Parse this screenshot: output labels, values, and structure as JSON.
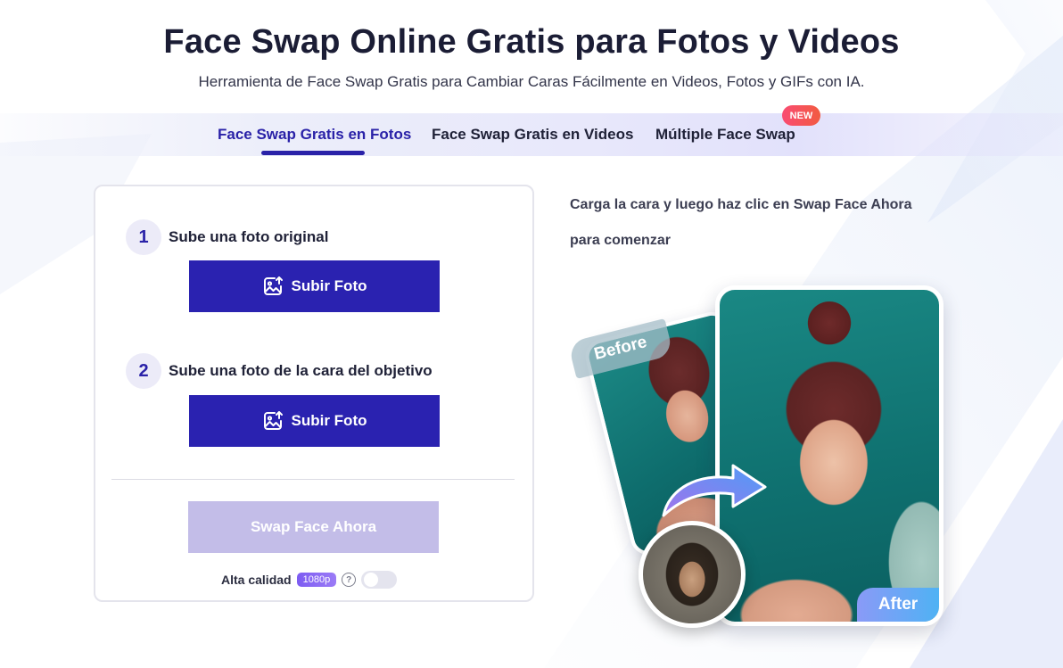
{
  "hero": {
    "title": "Face Swap Online Gratis para Fotos y Videos",
    "subtitle": "Herramienta de Face Swap Gratis para Cambiar Caras Fácilmente en Videos, Fotos y GIFs con IA."
  },
  "tabs": [
    {
      "label": "Face Swap Gratis en Fotos",
      "active": true
    },
    {
      "label": "Face Swap Gratis en Videos",
      "active": false
    },
    {
      "label": "Múltiple Face Swap",
      "active": false,
      "badge": "NEW"
    }
  ],
  "panel": {
    "steps": [
      {
        "number": "1",
        "label": "Sube una foto original",
        "button": "Subir Foto",
        "icon": "image-upload-icon"
      },
      {
        "number": "2",
        "label": "Sube una foto de la cara del objetivo",
        "button": "Subir Foto",
        "icon": "image-upload-icon"
      }
    ],
    "swap_button": "Swap Face Ahora",
    "quality": {
      "label": "Alta calidad",
      "resolution": "1080p",
      "help": "?",
      "enabled": false
    }
  },
  "instructions": {
    "line1": "Carga la cara y luego haz clic en Swap Face Ahora",
    "line2": "para comenzar"
  },
  "illustration": {
    "before_label": "Before",
    "after_label": "After"
  },
  "colors": {
    "primary": "#2a22b0",
    "primary_disabled": "#c3bde8",
    "badge_new": "#f94c73",
    "resolution_badge": "#8a6bf4"
  }
}
